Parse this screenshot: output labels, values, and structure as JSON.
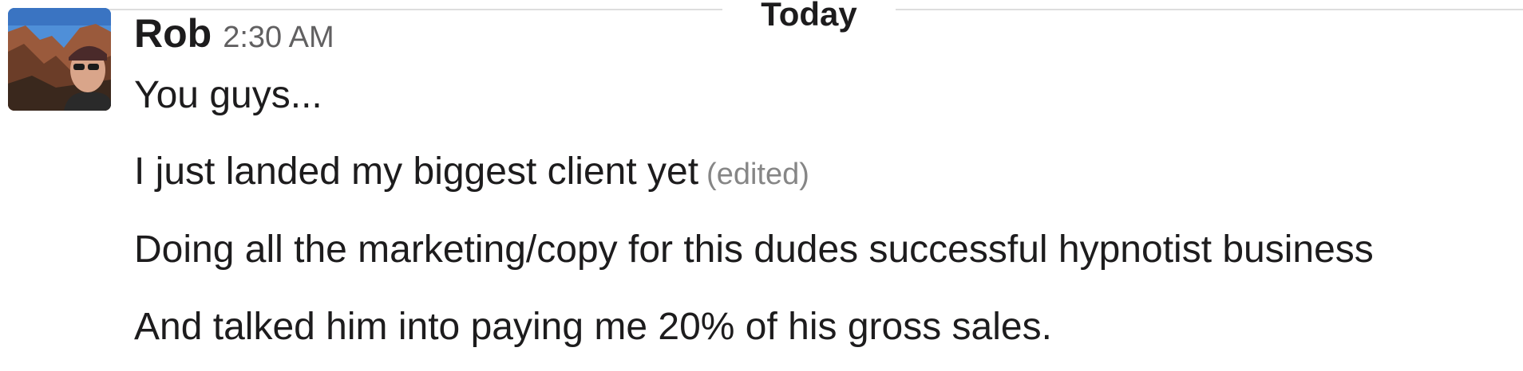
{
  "divider": {
    "label": "Today"
  },
  "message": {
    "sender": "Rob",
    "timestamp": "2:30 AM",
    "avatar_icon": "user-photo-avatar",
    "lines": [
      {
        "text": "You guys..."
      },
      {
        "text": "I just landed my biggest client yet",
        "edited": "(edited)"
      },
      {
        "text": "Doing all the marketing/copy for this dudes successful hypnotist business"
      },
      {
        "text": "And talked him into paying me 20% of his gross sales."
      }
    ]
  }
}
